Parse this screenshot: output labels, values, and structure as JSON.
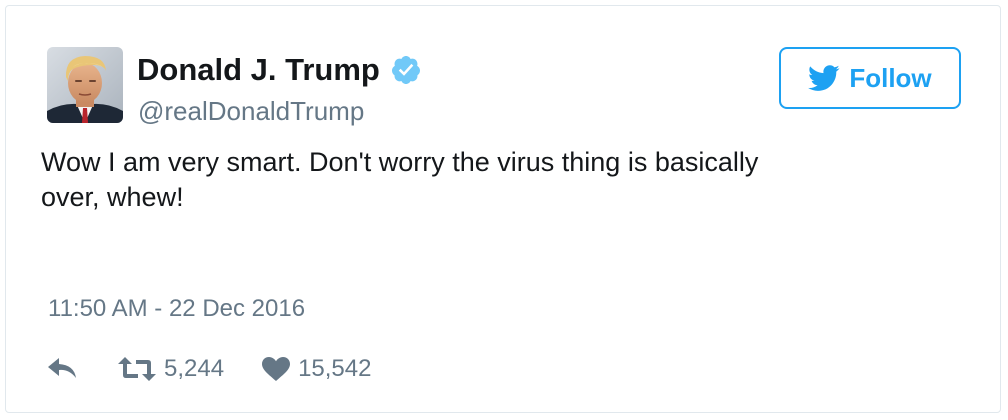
{
  "tweet": {
    "author": {
      "display_name": "Donald J. Trump",
      "handle": "@realDonaldTrump",
      "verified": true,
      "avatar_icon": "profile-photo"
    },
    "follow_button": {
      "label": "Follow",
      "icon": "twitter-bird-icon"
    },
    "text": "Wow I am very smart. Don't worry the virus thing is basically over, whew!",
    "timestamp": "11:50 AM - 22 Dec 2016",
    "actions": {
      "reply_icon": "reply-icon",
      "retweet_icon": "retweet-icon",
      "retweet_count": "5,244",
      "like_icon": "heart-icon",
      "like_count": "15,542"
    }
  },
  "colors": {
    "accent": "#1da1f2",
    "verified_badge": "#71c9f8",
    "text_primary": "#14171a",
    "text_secondary": "#657786",
    "border": "#e1e8ed"
  }
}
